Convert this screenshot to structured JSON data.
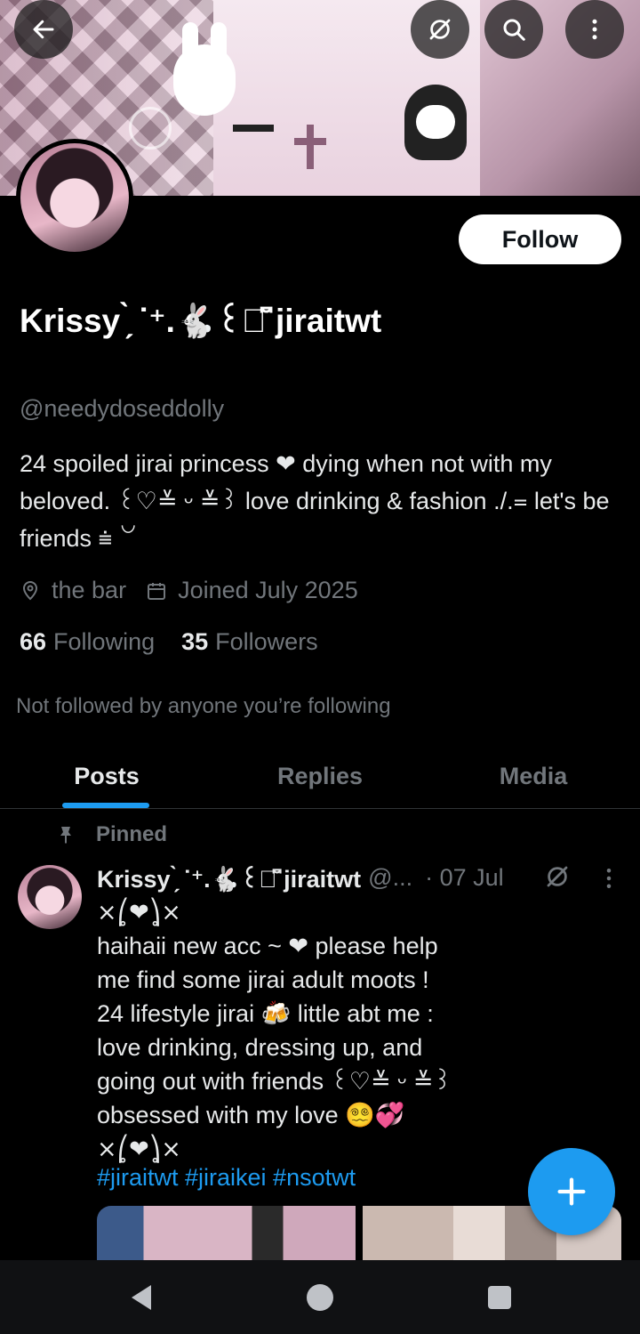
{
  "header": {
    "back_icon": "arrow-left-icon",
    "grok_icon": "grok-icon",
    "search_icon": "search-icon",
    "more_icon": "more-vertical-icon"
  },
  "profile": {
    "follow_label": "Follow",
    "display_name": "Krissy ̗̀ ᐝ⁺.🐇꒰ᦔ̆͆ jiraitwt",
    "handle": "@needydoseddolly",
    "bio": "24 spoiled jirai princess ❤ dying when not with my beloved. ꒰♡≚ ᵕ ≚꒱ love drinking & fashion ./.᐀ let's be friends ⩧ ꒡",
    "location": "the bar",
    "joined": "Joined July 2025",
    "following_count": "66",
    "following_label": "Following",
    "followers_count": "35",
    "followers_label": "Followers",
    "not_followed": "Not followed by anyone you’re following"
  },
  "tabs": [
    {
      "label": "Posts"
    },
    {
      "label": "Replies"
    },
    {
      "label": "Media"
    }
  ],
  "post": {
    "pinned_label": "Pinned",
    "name": "Krissy ̗̀ ᐝ⁺.🐇꒰ᦔ̆͆ jiraitwt",
    "handle": "@...",
    "date": "· 07 Jul",
    "body": "⨯⎛̥❤⎞̥⨯\nhaihaii new acc ~ ❤ please help\nme find some jirai adult moots !\n24 lifestyle jirai 🍻 little abt me :\nlove drinking, dressing up, and\ngoing out with friends ꒰♡≚ ᵕ ≚꒱\nobsessed with my love 😵‍💫💞\n⨯⎛̥❤⎞̥⨯",
    "hashtags": "#jiraitwt #jiraikei #nsotwt"
  },
  "colors": {
    "accent": "#1d9bf0",
    "muted": "#71767b",
    "text": "#e7e9ea",
    "background": "#000000"
  }
}
